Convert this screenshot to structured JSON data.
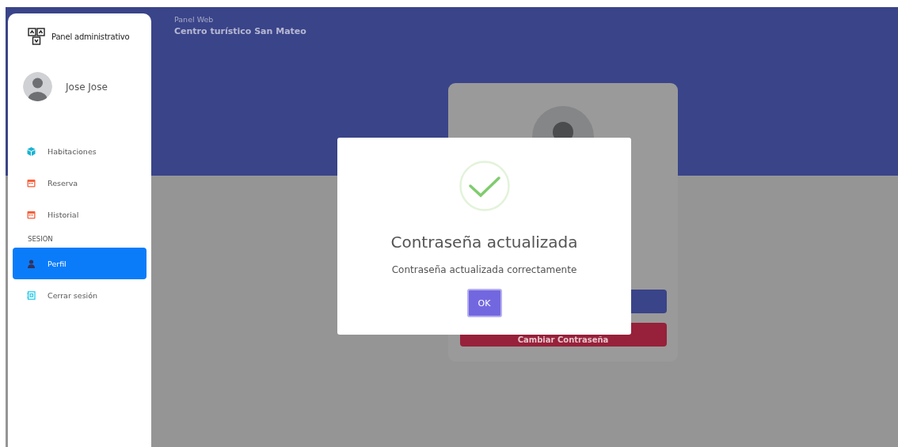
{
  "sidebar": {
    "title": "Panel administrativo",
    "user": {
      "name": "Jose Jose"
    },
    "items": [
      {
        "kind": "cube",
        "label": "Habitaciones",
        "selected": false
      },
      {
        "kind": "calendar",
        "label": "Reserva",
        "selected": false
      },
      {
        "kind": "calendar",
        "label": "Historial",
        "selected": false
      }
    ],
    "section": "SESION",
    "session_items": [
      {
        "kind": "person",
        "label": "Perfil",
        "selected": true
      },
      {
        "kind": "logout",
        "label": "Cerrar sesión",
        "selected": false
      }
    ]
  },
  "header": {
    "subtitle": "Panel Web",
    "title": "Centro turístico San Mateo"
  },
  "profile_card": {
    "buttons": [
      {
        "kind": "primary"
      },
      {
        "kind": "danger",
        "label": "Cambiar Contraseña"
      }
    ]
  },
  "dialog": {
    "title": "Contraseña actualizada",
    "message": "Contraseña actualizada correctamente",
    "button": "OK"
  }
}
